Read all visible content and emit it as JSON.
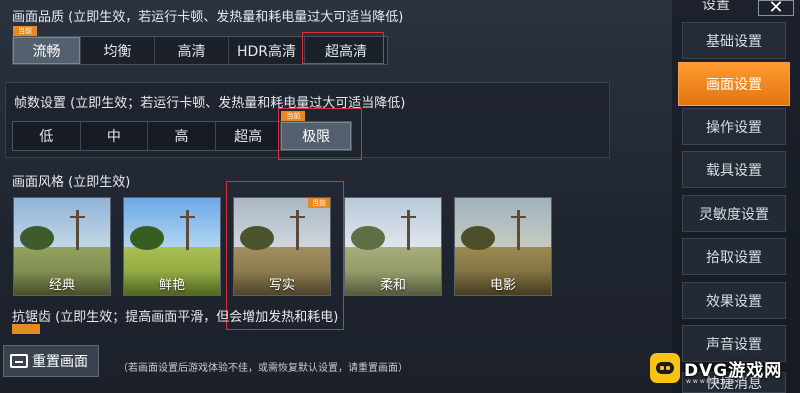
{
  "quality": {
    "title": "画面品质 (立即生效，若运行卡顿、发热量和耗电量过大可适当降低)",
    "tag": "当前",
    "options": [
      "流畅",
      "均衡",
      "高清",
      "HDR高清",
      "超高清"
    ],
    "selected": "流畅"
  },
  "framerate": {
    "title": "帧数设置 (立即生效；若运行卡顿、发热量和耗电量过大可适当降低)",
    "tag": "当前",
    "options": [
      "低",
      "中",
      "高",
      "超高",
      "极限"
    ],
    "selected": "极限"
  },
  "style": {
    "title": "画面风格 (立即生效)",
    "tag": "当前",
    "cards": [
      "经典",
      "鲜艳",
      "写实",
      "柔和",
      "电影"
    ],
    "selected": "写实"
  },
  "antialias": {
    "title": "抗锯齿 (立即生效；提高画面平滑，但会增加发热和耗电)"
  },
  "reset": {
    "label": "重置画面",
    "hint": "（若画面设置后游戏体验不佳，或需恢复默认设置，请重置画面）"
  },
  "sidebar": {
    "header": "设置",
    "items": [
      "基础设置",
      "画面设置",
      "操作设置",
      "载具设置",
      "灵敏度设置",
      "拾取设置",
      "效果设置",
      "声音设置",
      "快捷消息"
    ],
    "active": "画面设置"
  },
  "logo": {
    "text": "DVG游戏网",
    "sub": "www.dvg.cn"
  },
  "colors": {
    "accent": "#e48a22",
    "highlight_border": "#d8303b"
  }
}
